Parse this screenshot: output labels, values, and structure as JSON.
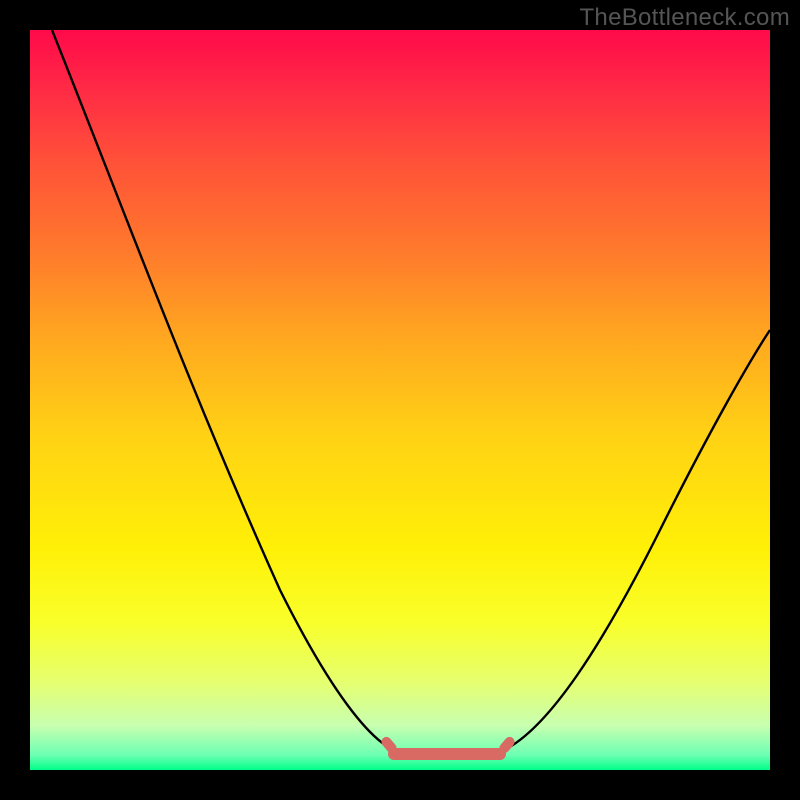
{
  "watermark": "TheBottleneck.com",
  "chart_data": {
    "type": "line",
    "title": "",
    "xlabel": "",
    "ylabel": "",
    "xlim": [
      0,
      1
    ],
    "ylim": [
      0,
      1
    ],
    "series": [
      {
        "name": "left-curve",
        "x": [
          0.03,
          0.08,
          0.14,
          0.2,
          0.26,
          0.32,
          0.38,
          0.44,
          0.48,
          0.5
        ],
        "values": [
          1.0,
          0.86,
          0.71,
          0.57,
          0.45,
          0.33,
          0.22,
          0.12,
          0.05,
          0.02
        ]
      },
      {
        "name": "valley-floor",
        "x": [
          0.5,
          0.55,
          0.6,
          0.63
        ],
        "values": [
          0.02,
          0.015,
          0.015,
          0.02
        ]
      },
      {
        "name": "right-curve",
        "x": [
          0.63,
          0.7,
          0.78,
          0.86,
          0.93,
          1.0
        ],
        "values": [
          0.02,
          0.09,
          0.19,
          0.3,
          0.41,
          0.53
        ]
      },
      {
        "name": "accent-band",
        "x": [
          0.49,
          0.63
        ],
        "values": [
          0.02,
          0.02
        ]
      }
    ],
    "colors": {
      "curve": "#000000",
      "accent": "#d86a63",
      "gradient_top": "#ff0a4a",
      "gradient_bottom": "#00ff88"
    }
  }
}
